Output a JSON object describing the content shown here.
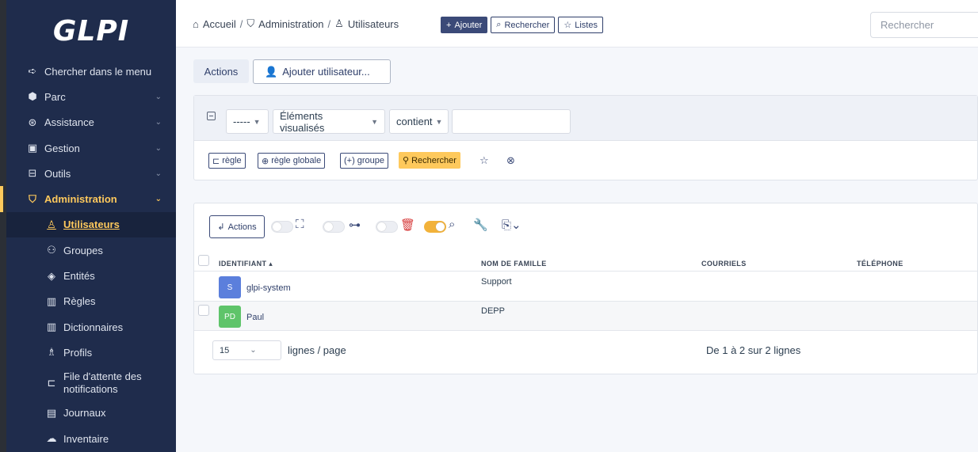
{
  "app": {
    "logo": "GLPI"
  },
  "sidebar": {
    "items": [
      {
        "label": "Chercher dans le menu",
        "icon": "arrow-right-icon"
      },
      {
        "label": "Parc",
        "icon": "package-icon"
      },
      {
        "label": "Assistance",
        "icon": "lifebuoy-icon"
      },
      {
        "label": "Gestion",
        "icon": "wallet-icon"
      },
      {
        "label": "Outils",
        "icon": "briefcase-icon"
      },
      {
        "label": "Administration",
        "icon": "shield-icon"
      }
    ],
    "sub_items": [
      {
        "label": "Utilisateurs",
        "icon": "user-icon"
      },
      {
        "label": "Groupes",
        "icon": "users-icon"
      },
      {
        "label": "Entités",
        "icon": "stack-icon"
      },
      {
        "label": "Règles",
        "icon": "book-icon"
      },
      {
        "label": "Dictionnaires",
        "icon": "book-icon"
      },
      {
        "label": "Profils",
        "icon": "user-check-icon"
      },
      {
        "label": "File d'attente des notifications",
        "icon": "notification-icon"
      },
      {
        "label": "Journaux",
        "icon": "news-icon"
      },
      {
        "label": "Inventaire",
        "icon": "cloud-upload-icon"
      }
    ]
  },
  "header": {
    "breadcrumb": [
      "Accueil",
      "Administration",
      "Utilisateurs"
    ],
    "add_label": "Ajouter",
    "search_label": "Rechercher",
    "lists_label": "Listes",
    "global_search_placeholder": "Rechercher"
  },
  "tabs": {
    "actions_label": "Actions",
    "add_user_label": "Ajouter utilisateur..."
  },
  "criteria": {
    "field_link": "-----",
    "field_name": "Éléments visualisés",
    "operator": "contient",
    "value": "",
    "rule_label": "règle",
    "global_rule_label": "règle globale",
    "group_label": "groupe",
    "search_label": "Rechercher"
  },
  "results": {
    "massive_actions_label": "Actions",
    "columns": [
      "IDENTIFIANT",
      "NOM DE FAMILLE",
      "COURRIELS",
      "TÉLÉPHONE"
    ],
    "rows": [
      {
        "avatar": "S",
        "avatar_color": "#5b7fdc",
        "login": "glpi-system",
        "lastname": "Support"
      },
      {
        "avatar": "PD",
        "avatar_color": "#5fc46a",
        "login": "Paul",
        "lastname": "DEPP"
      }
    ],
    "page_size": "15",
    "per_page_label": "lignes / page",
    "count_label": "De 1 à 2 sur 2 lignes"
  },
  "colors": {
    "sidebar_bg": "#1f2c4c",
    "accent": "#fec95c",
    "primary": "#3b4a78"
  }
}
